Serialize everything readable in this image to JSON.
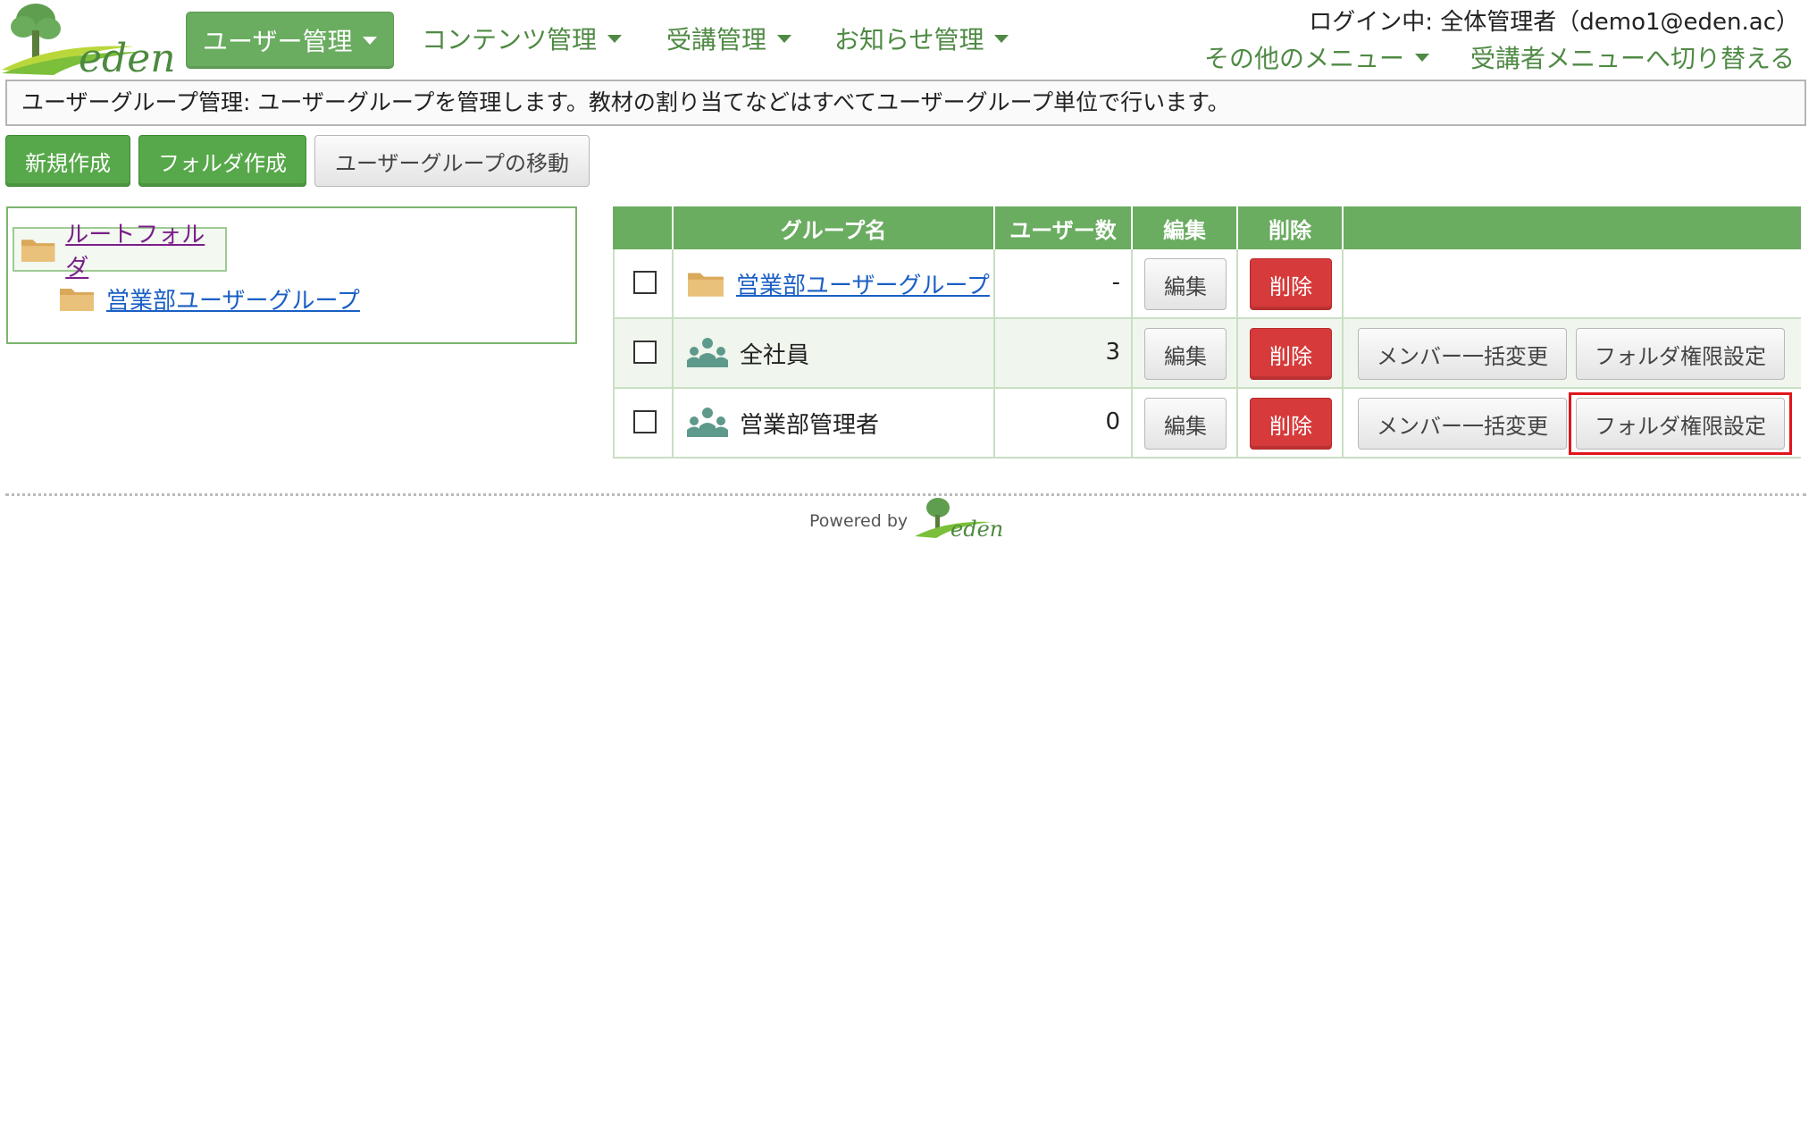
{
  "logo": {
    "text": "eden"
  },
  "nav": {
    "items": [
      {
        "label": "ユーザー管理",
        "active": true
      },
      {
        "label": "コンテンツ管理",
        "active": false
      },
      {
        "label": "受講管理",
        "active": false
      },
      {
        "label": "お知らせ管理",
        "active": false
      }
    ],
    "login_info": "ログイン中: 全体管理者（demo1@eden.ac）",
    "other_menu": "その他のメニュー",
    "switch_menu": "受講者メニューへ切り替える"
  },
  "description": "ユーザーグループ管理: ユーザーグループを管理します。教材の割り当てなどはすべてユーザーグループ単位で行います。",
  "actions": {
    "new": "新規作成",
    "folder": "フォルダ作成",
    "move": "ユーザーグループの移動"
  },
  "tree": {
    "root": "ルートフォルダ",
    "child": "営業部ユーザーグループ"
  },
  "table": {
    "headers": {
      "name": "グループ名",
      "users": "ユーザー数",
      "edit": "編集",
      "delete": "削除"
    },
    "rows": [
      {
        "type": "folder",
        "name": "営業部ユーザーグループ",
        "count": "-",
        "edit": "編集",
        "delete": "削除"
      },
      {
        "type": "group",
        "name": "全社員",
        "count": "3",
        "edit": "編集",
        "delete": "削除",
        "members": "メンバー一括変更",
        "permission": "フォルダ権限設定"
      },
      {
        "type": "group",
        "name": "営業部管理者",
        "count": "0",
        "edit": "編集",
        "delete": "削除",
        "members": "メンバー一括変更",
        "permission": "フォルダ権限設定"
      }
    ]
  },
  "footer": {
    "powered_by": "Powered by",
    "brand": "eden"
  },
  "colors": {
    "brand_green": "#6aac60",
    "delete_red": "#d63a3a",
    "highlight_red": "#e0151b"
  }
}
